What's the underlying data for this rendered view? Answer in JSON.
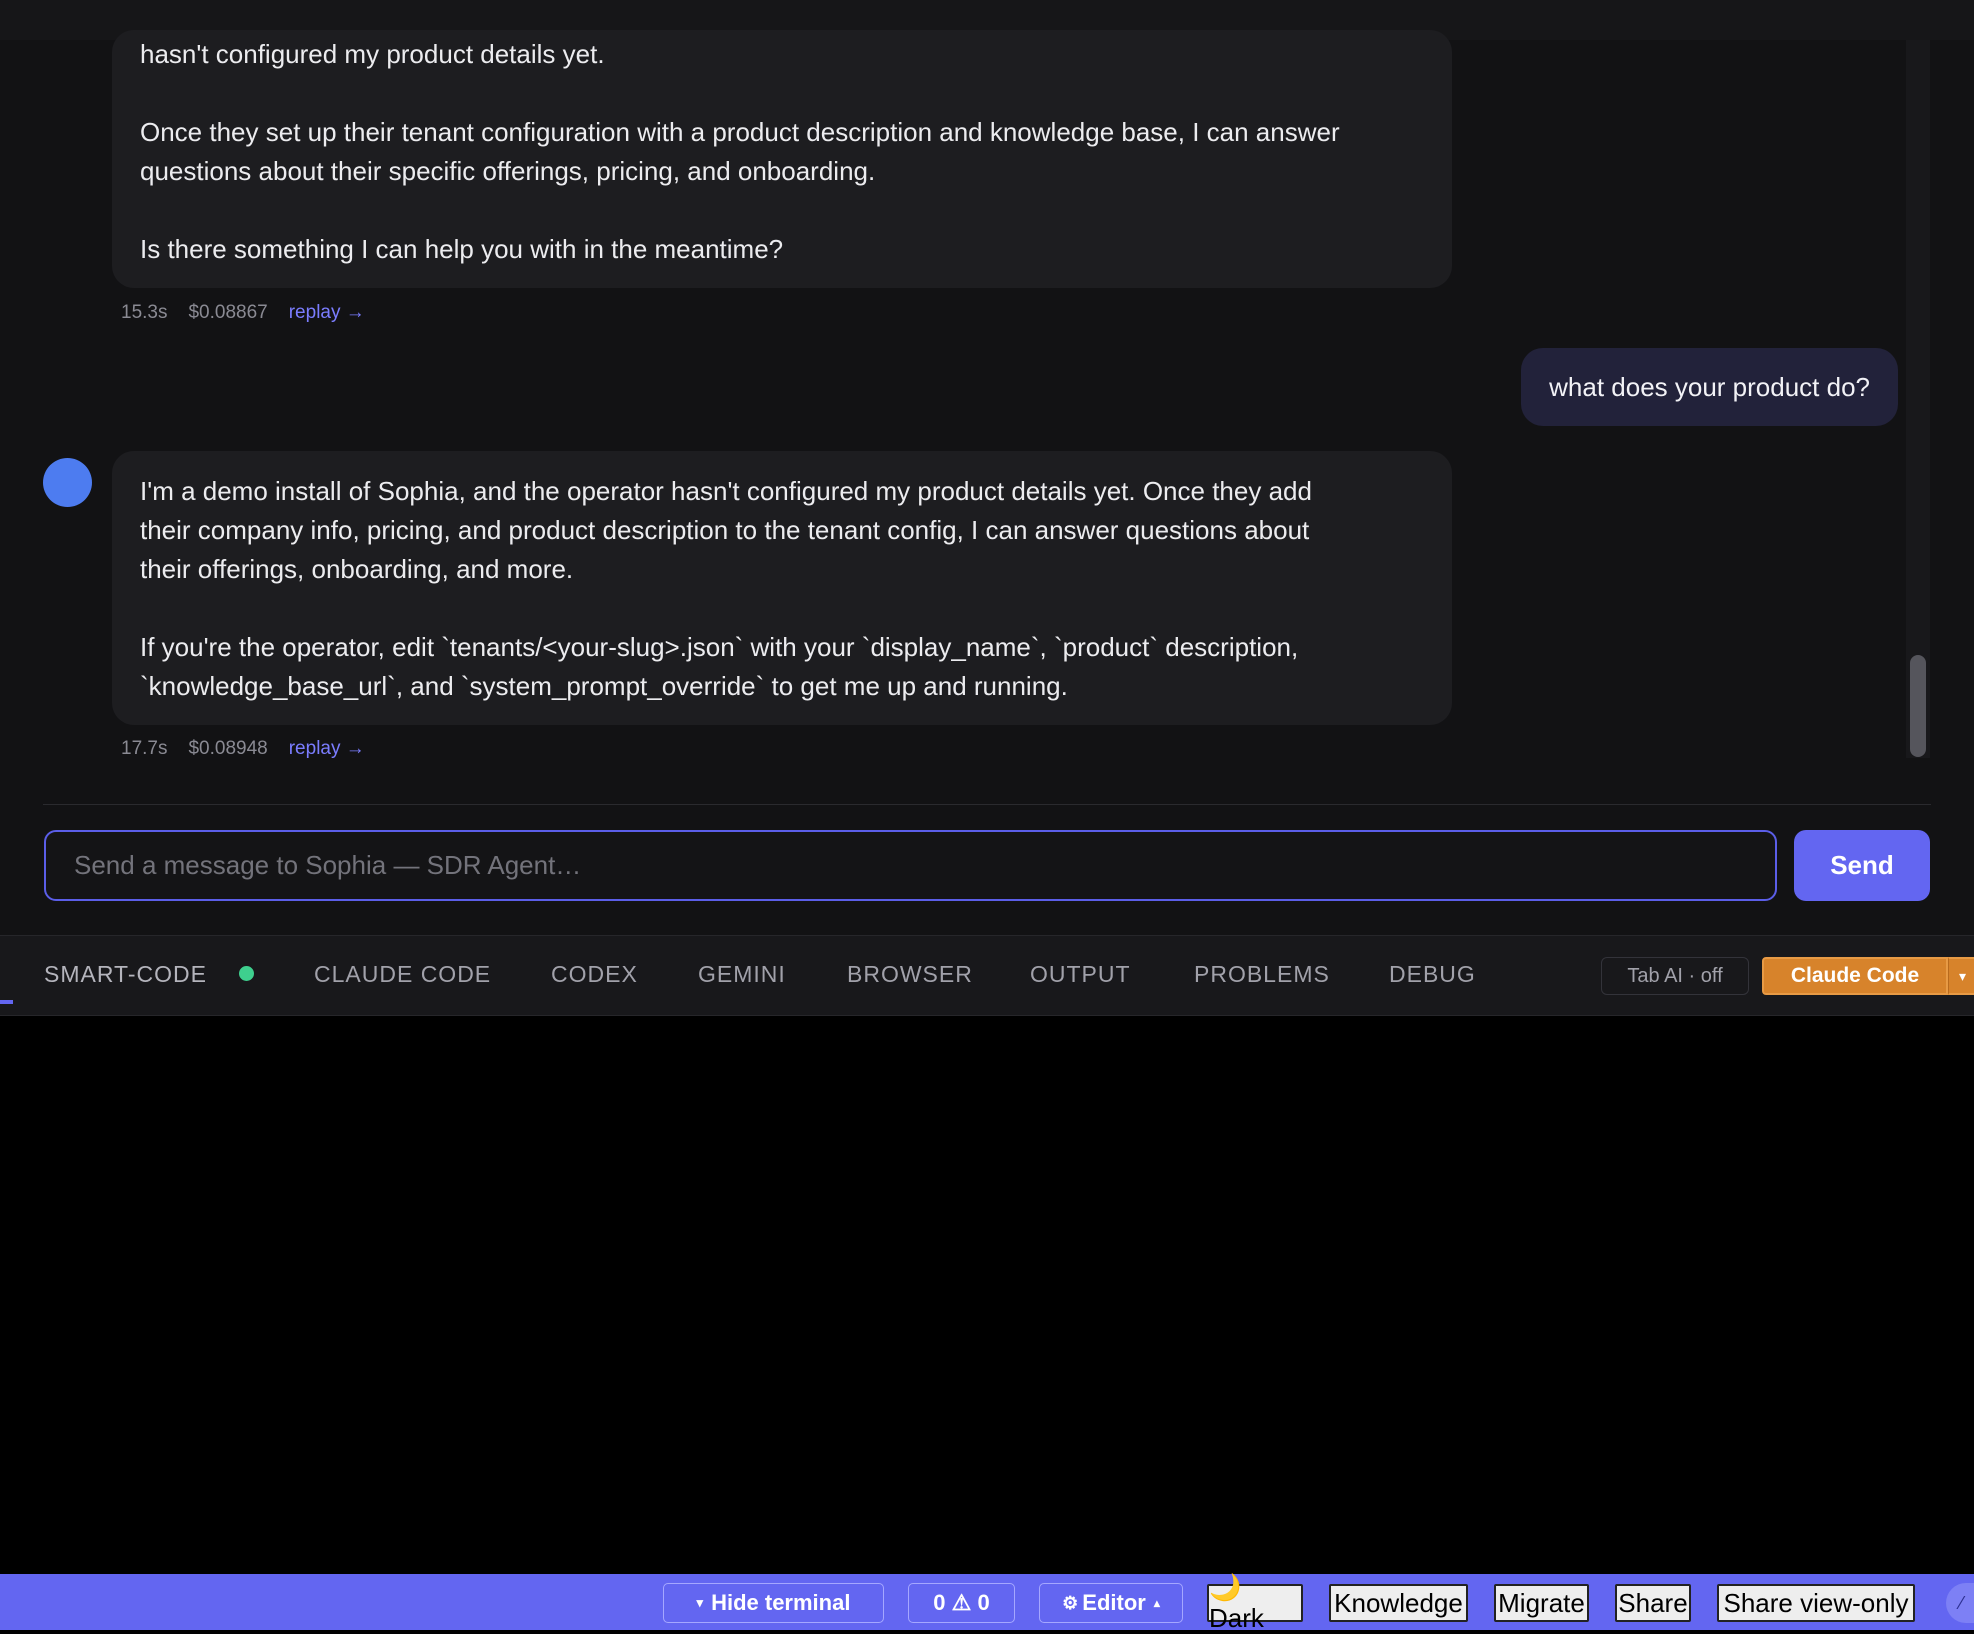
{
  "chat": {
    "prev_message": {
      "line1": "hasn't configured my product details yet.",
      "para2_l1": "Once they set up their tenant configuration with a product description and knowledge base, I can answer",
      "para2_l2": "questions about their specific offerings, pricing, and onboarding.",
      "para3": "Is there something I can help you with in the meantime?",
      "time": "15.3s",
      "cost": "$0.08867",
      "replay": "replay →"
    },
    "user_message": "what does your product do?",
    "agent_message": {
      "para1_l1": "I'm a demo install of Sophia, and the operator hasn't configured my product details yet. Once they add",
      "para1_l2": "their company info, pricing, and product description to the tenant config, I can answer questions about",
      "para1_l3": "their offerings, onboarding, and more.",
      "para2_l1": "If you're the operator, edit `tenants/<your-slug>.json` with your `display_name`, `product` description,",
      "para2_l2": "`knowledge_base_url`, and `system_prompt_override` to get me up and running.",
      "time": "17.7s",
      "cost": "$0.08948",
      "replay": "replay →"
    },
    "input_placeholder": "Send a message to Sophia — SDR Agent…",
    "send_label": "Send"
  },
  "panel": {
    "tabs": [
      "SMART-CODE",
      "CLAUDE CODE",
      "CODEX",
      "GEMINI",
      "BROWSER",
      "OUTPUT",
      "PROBLEMS",
      "DEBUG"
    ],
    "tab_ai": "Tab AI · off",
    "claude_button": "Claude Code",
    "caret": "▾"
  },
  "status_bar": {
    "hide_terminal": "Hide terminal",
    "problems": "0 ⚠ 0",
    "editor": "Editor",
    "dark": "🌙 Dark",
    "knowledge": "Knowledge",
    "migrate": "Migrate",
    "share": "Share",
    "share_view_only": "Share view-only",
    "corner": "⁄"
  },
  "icons": {
    "down_triangle": "▾",
    "gear": "⚙",
    "up_triangle": "▴"
  },
  "colors": {
    "accent": "#6366f1",
    "status_dot": "#3ecf8e",
    "avatar": "#4d7cf0",
    "claude_orange": "#d7832b"
  }
}
